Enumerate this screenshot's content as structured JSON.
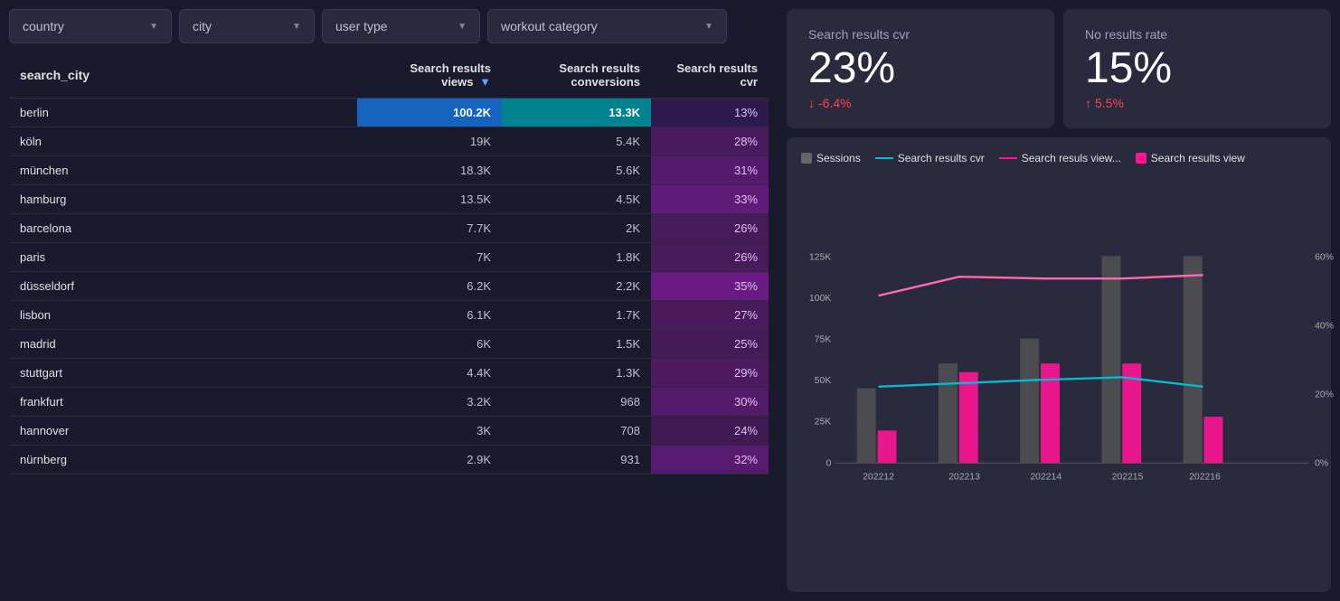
{
  "filters": {
    "country": {
      "label": "country",
      "icon": "chevron-down"
    },
    "city": {
      "label": "city",
      "icon": "chevron-down"
    },
    "usertype": {
      "label": "user type",
      "icon": "chevron-down"
    },
    "workout": {
      "label": "workout category",
      "icon": "chevron-down"
    }
  },
  "table": {
    "columns": [
      {
        "id": "city",
        "label": "search_city",
        "align": "left"
      },
      {
        "id": "views",
        "label": "Search results views",
        "sort": "▼",
        "align": "right"
      },
      {
        "id": "conversions",
        "label": "Search results conversions",
        "align": "right"
      },
      {
        "id": "cvr",
        "label": "Search results cvr",
        "align": "right"
      }
    ],
    "rows": [
      {
        "city": "berlin",
        "views": "100.2K",
        "conversions": "13.3K",
        "cvr": "13%",
        "views_highlight": "blue",
        "conv_highlight": "teal"
      },
      {
        "city": "köln",
        "views": "19K",
        "conversions": "5.4K",
        "cvr": "28%"
      },
      {
        "city": "münchen",
        "views": "18.3K",
        "conversions": "5.6K",
        "cvr": "31%"
      },
      {
        "city": "hamburg",
        "views": "13.5K",
        "conversions": "4.5K",
        "cvr": "33%"
      },
      {
        "city": "barcelona",
        "views": "7.7K",
        "conversions": "2K",
        "cvr": "26%"
      },
      {
        "city": "paris",
        "views": "7K",
        "conversions": "1.8K",
        "cvr": "26%"
      },
      {
        "city": "düsseldorf",
        "views": "6.2K",
        "conversions": "2.2K",
        "cvr": "35%"
      },
      {
        "city": "lisbon",
        "views": "6.1K",
        "conversions": "1.7K",
        "cvr": "27%"
      },
      {
        "city": "madrid",
        "views": "6K",
        "conversions": "1.5K",
        "cvr": "25%"
      },
      {
        "city": "stuttgart",
        "views": "4.4K",
        "conversions": "1.3K",
        "cvr": "29%"
      },
      {
        "city": "frankfurt",
        "views": "3.2K",
        "conversions": "968",
        "cvr": "30%"
      },
      {
        "city": "hannover",
        "views": "3K",
        "conversions": "708",
        "cvr": "24%"
      },
      {
        "city": "nürnberg",
        "views": "2.9K",
        "conversions": "931",
        "cvr": "32%"
      }
    ]
  },
  "kpi": {
    "cvr": {
      "label": "Search results cvr",
      "value": "23%",
      "change": "-6.4%",
      "change_dir": "down"
    },
    "no_results": {
      "label": "No results rate",
      "value": "15%",
      "change": "5.5%",
      "change_dir": "up"
    }
  },
  "chart": {
    "legend": [
      {
        "type": "bar",
        "color": "gray",
        "label": "Sessions"
      },
      {
        "type": "line",
        "color": "teal",
        "label": "Search results cvr"
      },
      {
        "type": "line",
        "color": "pink",
        "label": "Search resuls view..."
      },
      {
        "type": "bar",
        "color": "pink",
        "label": "Search results view"
      }
    ],
    "y_left": [
      "125K",
      "100K",
      "75K",
      "50K",
      "25K",
      "0"
    ],
    "y_right": [
      "60%",
      "40%",
      "20%",
      "0%"
    ],
    "x_labels": [
      "202212",
      "202213",
      "202214",
      "202215",
      "202216"
    ],
    "sessions": [
      45000,
      60000,
      75000,
      130000,
      125000
    ],
    "views": [
      20000,
      55000,
      60000,
      60000,
      28000
    ],
    "cvr_line": [
      50000,
      48000,
      46000,
      44000,
      50000
    ],
    "views_line": [
      100000,
      105000,
      104000,
      104000,
      106000
    ]
  }
}
